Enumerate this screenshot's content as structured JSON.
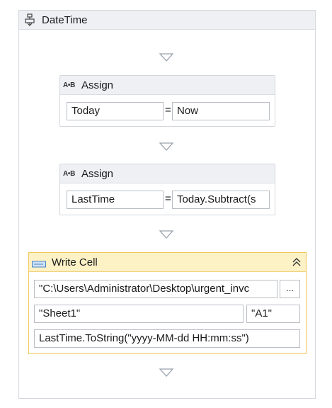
{
  "sequence": {
    "title": "DateTime"
  },
  "assign1": {
    "title": "Assign",
    "to": "Today",
    "equals": "=",
    "value": "Now"
  },
  "assign2": {
    "title": "Assign",
    "to": "LastTime",
    "equals": "=",
    "value": "Today.Subtract(s"
  },
  "write_cell": {
    "title": "Write Cell",
    "workbook_path": "\"C:\\Users\\Administrator\\Desktop\\urgent_invc",
    "browse_label": "...",
    "sheet_name": "\"Sheet1\"",
    "cell": "\"A1\"",
    "text": "LastTime.ToString(\"yyyy-MM-dd HH:mm:ss\")"
  },
  "icons": {
    "sequence": "sequence-icon",
    "assign": "assign-ab-icon",
    "write_cell": "write-cell-icon",
    "collapse": "collapse-double-chevron-icon",
    "drop": "drop-zone-triangle-icon"
  },
  "colors": {
    "header_gray": "#eef0f3",
    "write_cell_border": "#f1c75a",
    "write_cell_header": "#fdf1c6"
  }
}
